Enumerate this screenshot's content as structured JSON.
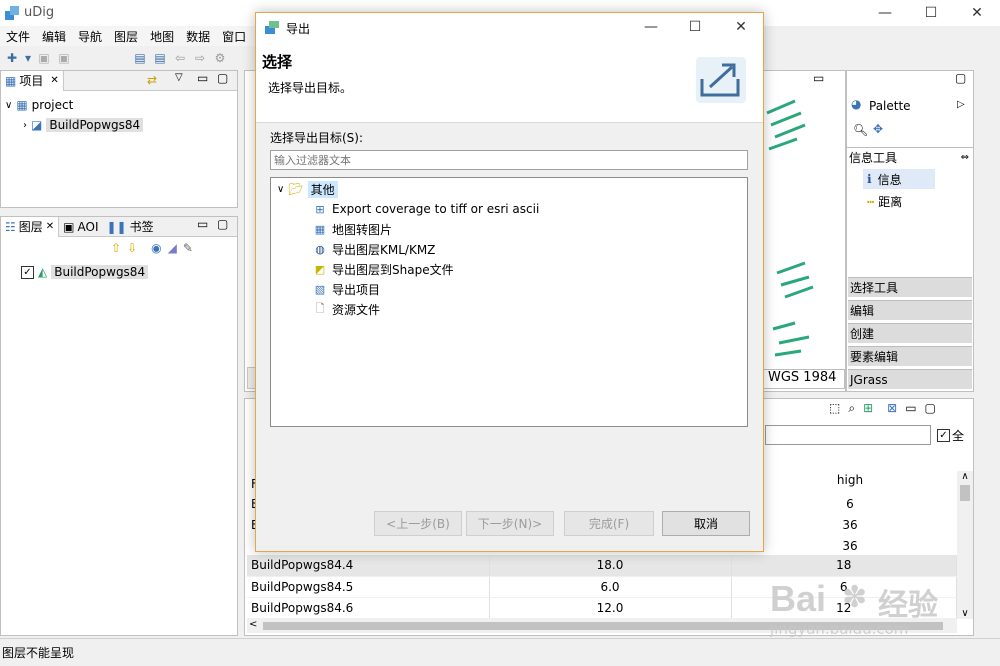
{
  "app": {
    "title": "uDig"
  },
  "menu": [
    "文件",
    "编辑",
    "导航",
    "图层",
    "地图",
    "数据",
    "窗口"
  ],
  "projects_panel": {
    "tab": "项目",
    "root": "project",
    "child": "BuildPopwgs84"
  },
  "layers_panel": {
    "tabs": [
      "图层",
      "AOI",
      "书签"
    ],
    "layer": "BuildPopwgs84"
  },
  "palette": {
    "title": "Palette",
    "info_tools": "信息工具",
    "info": "信息",
    "distance": "距离",
    "categories": [
      "选择工具",
      "编辑",
      "创建",
      "要素编辑",
      "JGrass"
    ]
  },
  "map": {
    "crs_fragment": "WGS 1984"
  },
  "attributes": {
    "select_all": "全",
    "col_high": "high",
    "partial_rows": [
      {
        "first": "F",
        "high": "6"
      },
      {
        "first": "E",
        "high": "36"
      },
      {
        "first": "E",
        "high": "36"
      }
    ],
    "rows": [
      {
        "name": "BuildPopwgs84.4",
        "value": "18.0",
        "high": "18"
      },
      {
        "name": "BuildPopwgs84.5",
        "value": "6.0",
        "high": "6"
      },
      {
        "name": "BuildPopwgs84.6",
        "value": "12.0",
        "high": "12"
      }
    ]
  },
  "status": {
    "text": "图层不能呈现"
  },
  "dialog": {
    "title": "导出",
    "header_title": "选择",
    "header_desc": "选择导出目标。",
    "target_label": "选择导出目标(S):",
    "filter_placeholder": "输入过滤器文本",
    "tree_root": "其他",
    "tree_items": [
      {
        "label": "Export coverage to tiff or esri ascii",
        "icon": "plus-grid-icon"
      },
      {
        "label": "地图转图片",
        "icon": "map-grid-icon"
      },
      {
        "label": "导出图层KML/KMZ",
        "icon": "globe-icon"
      },
      {
        "label": "导出图层到Shape文件",
        "icon": "shape-file-icon"
      },
      {
        "label": "导出项目",
        "icon": "project-export-icon"
      },
      {
        "label": "资源文件",
        "icon": "resource-file-icon"
      }
    ],
    "buttons": {
      "back": "<上一步(B)",
      "next": "下一步(N)>",
      "finish": "完成(F)",
      "cancel": "取消"
    }
  },
  "watermark": {
    "brand": "Bai",
    "brand2": "经验",
    "url": "jingyan.baidu.com"
  }
}
